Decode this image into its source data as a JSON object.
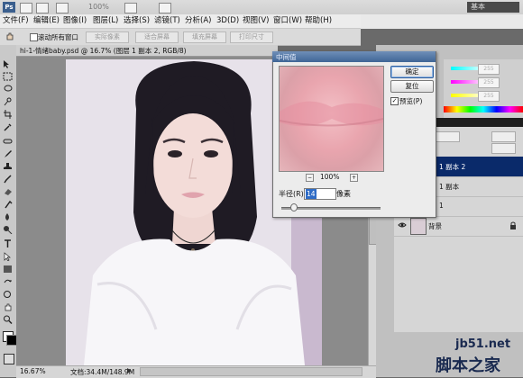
{
  "window": {
    "title_right": "基本",
    "zoom": "100%"
  },
  "menu": [
    {
      "label": "文件(F)"
    },
    {
      "label": "编辑(E)"
    },
    {
      "label": "图像(I)"
    },
    {
      "label": "图层(L)"
    },
    {
      "label": "选择(S)"
    },
    {
      "label": "滤镜(T)"
    },
    {
      "label": "分析(A)"
    },
    {
      "label": "3D(D)"
    },
    {
      "label": "视图(V)"
    },
    {
      "label": "窗口(W)"
    },
    {
      "label": "帮助(H)"
    }
  ],
  "options_bar": {
    "scroll_all": "滚动所有窗口",
    "buttons": [
      "实际像素",
      "适合屏幕",
      "填充屏幕",
      "打印尺寸"
    ]
  },
  "document": {
    "tab_title": "hi-1-情绪baby.psd @ 16.7% (图层 1 副本 2, RGB/8)",
    "zoom": "16.67%",
    "doc_size": "文档:34.4M/148.9M"
  },
  "dialog": {
    "title": "中间值",
    "ok": "确定",
    "reset": "复位",
    "preview_label": "预览(P)",
    "preview_checked": true,
    "zoom_level": "100%",
    "zoom_out": "−",
    "zoom_in": "+",
    "radius_label": "半径(R):",
    "radius_value": "14",
    "radius_unit": "像素"
  },
  "color_panel": {
    "fields": [
      "255",
      "255",
      "255"
    ]
  },
  "layers": {
    "rows": [
      {
        "name": "1 副本 2",
        "selected": true
      },
      {
        "name": "1 副本",
        "selected": false
      },
      {
        "name": "1",
        "selected": false
      },
      {
        "name": "背景",
        "selected": false,
        "lock": true
      }
    ]
  },
  "watermark": {
    "url": "jb51.net",
    "site": "脚本之家"
  }
}
